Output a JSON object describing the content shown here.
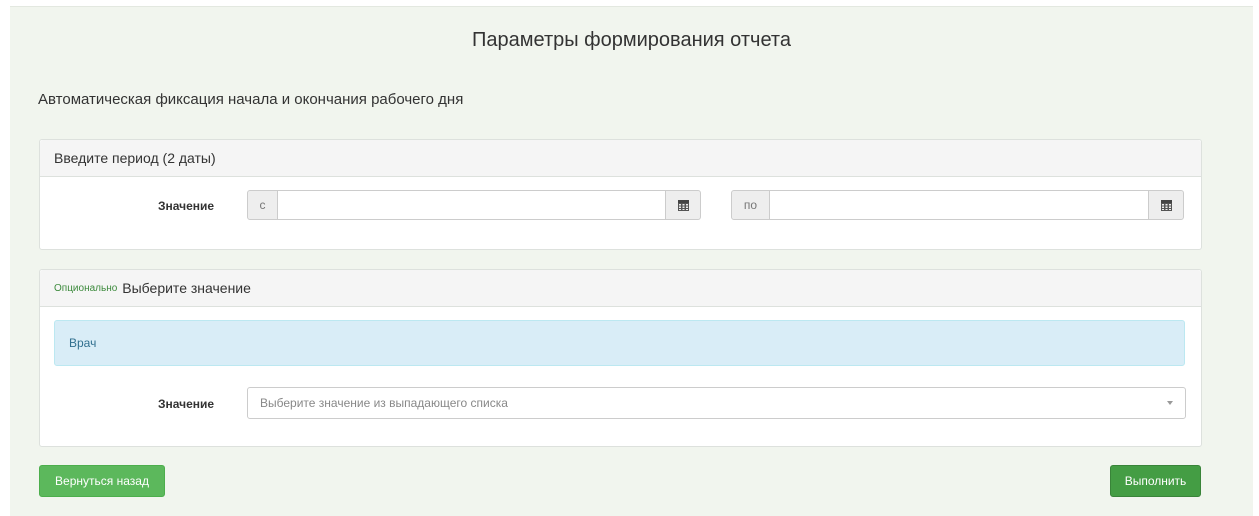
{
  "header": {
    "title": "Параметры формирования отчета",
    "report_name": "Автоматическая фиксация начала и окончания рабочего дня"
  },
  "period_panel": {
    "heading": "Введите период (2 даты)",
    "field_label": "Значение",
    "from_prefix": "с",
    "to_prefix": "по",
    "from_value": "",
    "to_value": "",
    "calendar_icon": "calendar-icon"
  },
  "select_panel": {
    "optional_tag": "Опционально",
    "heading": "Выберите значение",
    "info_label": "Врач",
    "field_label": "Значение",
    "select_placeholder": "Выберите значение из выпадающего списка",
    "dropdown_icon": "caret-down-icon"
  },
  "actions": {
    "back_label": "Вернуться назад",
    "run_label": "Выполнить"
  },
  "colors": {
    "background": "#f1f5ee",
    "button": "#5cb85c",
    "info": "#d9edf7",
    "optional": "#3c8a3c"
  }
}
